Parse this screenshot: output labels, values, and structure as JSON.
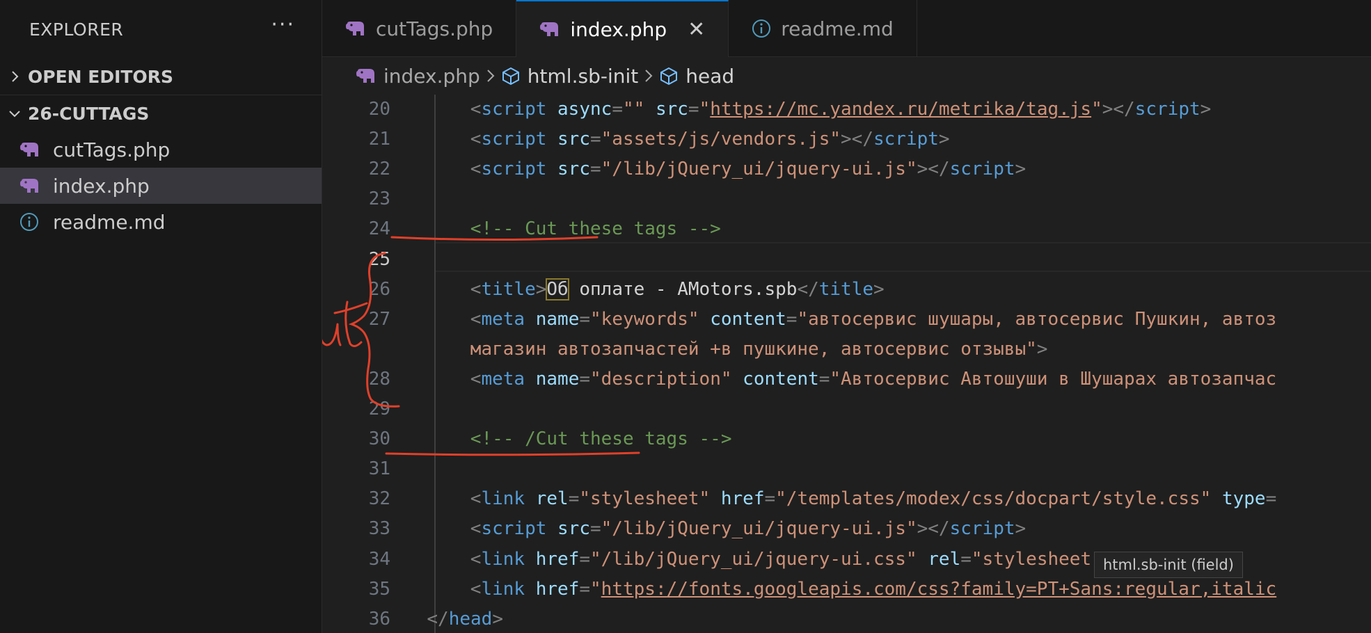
{
  "sidebar": {
    "title": "EXPLORER",
    "more": "···",
    "sections": [
      {
        "label": "OPEN EDITORS",
        "expanded": false
      },
      {
        "label": "26-CUTTAGS",
        "expanded": true
      }
    ],
    "files": [
      {
        "name": "cutTags.php",
        "icon": "php-elephant-icon",
        "active": false
      },
      {
        "name": "index.php",
        "icon": "php-elephant-icon",
        "active": true
      },
      {
        "name": "readme.md",
        "icon": "info-icon",
        "active": false
      }
    ]
  },
  "tabs": [
    {
      "label": "cutTags.php",
      "icon": "php-elephant-icon",
      "active": false
    },
    {
      "label": "index.php",
      "icon": "php-elephant-icon",
      "active": true,
      "close": "✕"
    },
    {
      "label": "readme.md",
      "icon": "info-icon",
      "active": false
    }
  ],
  "breadcrumb": {
    "file": "index.php",
    "element": "html.sb-init",
    "child": "head"
  },
  "editor": {
    "current_line": 25,
    "lines": [
      {
        "n": "20",
        "indent": 2,
        "tokens": [
          [
            "br",
            "<"
          ],
          [
            "tag",
            "script"
          ],
          [
            "tx",
            " "
          ],
          [
            "at",
            "async"
          ],
          [
            "br",
            "="
          ],
          [
            "str",
            "\"\""
          ],
          [
            "tx",
            " "
          ],
          [
            "at",
            "src"
          ],
          [
            "br",
            "="
          ],
          [
            "str",
            "\""
          ],
          [
            "url",
            "https://mc.yandex.ru/metrika/tag.js"
          ],
          [
            "str",
            "\""
          ],
          [
            "br",
            "></"
          ],
          [
            "tag",
            "script"
          ],
          [
            "br",
            ">"
          ]
        ]
      },
      {
        "n": "21",
        "indent": 2,
        "tokens": [
          [
            "br",
            "<"
          ],
          [
            "tag",
            "script"
          ],
          [
            "tx",
            " "
          ],
          [
            "at",
            "src"
          ],
          [
            "br",
            "="
          ],
          [
            "str",
            "\"assets/js/vendors.js\""
          ],
          [
            "br",
            "></"
          ],
          [
            "tag",
            "script"
          ],
          [
            "br",
            ">"
          ]
        ]
      },
      {
        "n": "22",
        "indent": 2,
        "tokens": [
          [
            "br",
            "<"
          ],
          [
            "tag",
            "script"
          ],
          [
            "tx",
            " "
          ],
          [
            "at",
            "src"
          ],
          [
            "br",
            "="
          ],
          [
            "str",
            "\"/lib/jQuery_ui/jquery-ui.js\""
          ],
          [
            "br",
            "></"
          ],
          [
            "tag",
            "script"
          ],
          [
            "br",
            ">"
          ]
        ]
      },
      {
        "n": "23",
        "indent": 2,
        "tokens": []
      },
      {
        "n": "24",
        "indent": 2,
        "tokens": [
          [
            "cm",
            "<!-- Cut these tags -->"
          ]
        ]
      },
      {
        "n": "25",
        "indent": 2,
        "tokens": []
      },
      {
        "n": "26",
        "indent": 2,
        "tokens": [
          [
            "br",
            "<"
          ],
          [
            "tag",
            "title"
          ],
          [
            "br",
            ">"
          ],
          [
            "hl",
            "Об"
          ],
          [
            "tx",
            " оплате - AMotors.spb"
          ],
          [
            "br",
            "</"
          ],
          [
            "tag",
            "title"
          ],
          [
            "br",
            ">"
          ]
        ]
      },
      {
        "n": "27",
        "indent": 2,
        "tokens": [
          [
            "br",
            "<"
          ],
          [
            "tag",
            "meta"
          ],
          [
            "tx",
            " "
          ],
          [
            "at",
            "name"
          ],
          [
            "br",
            "="
          ],
          [
            "str",
            "\"keywords\""
          ],
          [
            "tx",
            " "
          ],
          [
            "at",
            "content"
          ],
          [
            "br",
            "="
          ],
          [
            "str",
            "\"автосервис шушары, автосервис Пушкин, автоз"
          ]
        ]
      },
      {
        "n": "",
        "indent": 2,
        "tokens": [
          [
            "str",
            "магазин автозапчастей +в пушкине, автосервис отзывы\""
          ],
          [
            "br",
            ">"
          ]
        ]
      },
      {
        "n": "28",
        "indent": 2,
        "tokens": [
          [
            "br",
            "<"
          ],
          [
            "tag",
            "meta"
          ],
          [
            "tx",
            " "
          ],
          [
            "at",
            "name"
          ],
          [
            "br",
            "="
          ],
          [
            "str",
            "\"description\""
          ],
          [
            "tx",
            " "
          ],
          [
            "at",
            "content"
          ],
          [
            "br",
            "="
          ],
          [
            "str",
            "\"Автосервис Автошуши в Шушарах автозапчас"
          ]
        ]
      },
      {
        "n": "29",
        "indent": 2,
        "tokens": []
      },
      {
        "n": "30",
        "indent": 2,
        "tokens": [
          [
            "cm",
            "<!-- /Cut these tags -->"
          ]
        ]
      },
      {
        "n": "31",
        "indent": 2,
        "tokens": []
      },
      {
        "n": "32",
        "indent": 2,
        "tokens": [
          [
            "br",
            "<"
          ],
          [
            "tag",
            "link"
          ],
          [
            "tx",
            " "
          ],
          [
            "at",
            "rel"
          ],
          [
            "br",
            "="
          ],
          [
            "str",
            "\"stylesheet\""
          ],
          [
            "tx",
            " "
          ],
          [
            "at",
            "href"
          ],
          [
            "br",
            "="
          ],
          [
            "str",
            "\"/templates/modex/css/docpart/style.css\""
          ],
          [
            "tx",
            " "
          ],
          [
            "at",
            "type"
          ],
          [
            "br",
            "="
          ]
        ]
      },
      {
        "n": "33",
        "indent": 2,
        "tokens": [
          [
            "br",
            "<"
          ],
          [
            "tag",
            "script"
          ],
          [
            "tx",
            " "
          ],
          [
            "at",
            "src"
          ],
          [
            "br",
            "="
          ],
          [
            "str",
            "\"/lib/jQuery_ui/jquery-ui.js\""
          ],
          [
            "br",
            "></"
          ],
          [
            "tag",
            "script"
          ],
          [
            "br",
            ">"
          ]
        ]
      },
      {
        "n": "34",
        "indent": 2,
        "tokens": [
          [
            "br",
            "<"
          ],
          [
            "tag",
            "link"
          ],
          [
            "tx",
            " "
          ],
          [
            "at",
            "href"
          ],
          [
            "br",
            "="
          ],
          [
            "str",
            "\"/lib/jQuery_ui/jquery-ui.css\""
          ],
          [
            "tx",
            " "
          ],
          [
            "at",
            "rel"
          ],
          [
            "br",
            "="
          ],
          [
            "str",
            "\"stylesheet\""
          ]
        ]
      },
      {
        "n": "35",
        "indent": 2,
        "tokens": [
          [
            "br",
            "<"
          ],
          [
            "tag",
            "link"
          ],
          [
            "tx",
            " "
          ],
          [
            "at",
            "href"
          ],
          [
            "br",
            "="
          ],
          [
            "str",
            "\""
          ],
          [
            "url",
            "https://fonts.googleapis.com/css?family=PT+Sans:regular,italic"
          ]
        ]
      },
      {
        "n": "36",
        "indent": 1,
        "tokens": [
          [
            "br",
            "</"
          ],
          [
            "tag",
            "head"
          ],
          [
            "br",
            ">"
          ]
        ]
      }
    ]
  },
  "annotation": {
    "text": "cut",
    "color": "#e0402a"
  },
  "tooltip": "html.sb-init (field)"
}
